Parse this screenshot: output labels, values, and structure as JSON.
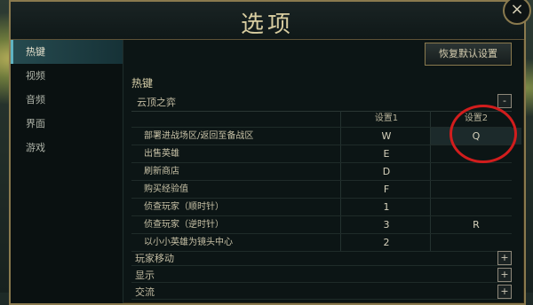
{
  "window": {
    "title": "选项",
    "close_label": "×"
  },
  "sidebar": {
    "items": [
      {
        "label": "热键",
        "active": true
      },
      {
        "label": "视频",
        "active": false
      },
      {
        "label": "音频",
        "active": false
      },
      {
        "label": "界面",
        "active": false
      },
      {
        "label": "游戏",
        "active": false
      }
    ]
  },
  "main": {
    "reset_label": "恢复默认设置",
    "section_title": "热键",
    "group": {
      "label": "云顶之弈",
      "toggle": "-"
    },
    "columns": [
      "设置1",
      "设置2"
    ],
    "rows": [
      {
        "action": "部署进战场区/返回至备战区",
        "key1": "W",
        "key2": "Q"
      },
      {
        "action": "出售英雄",
        "key1": "E",
        "key2": ""
      },
      {
        "action": "刷新商店",
        "key1": "D",
        "key2": ""
      },
      {
        "action": "购买经验值",
        "key1": "F",
        "key2": ""
      },
      {
        "action": "侦查玩家（顺时针）",
        "key1": "1",
        "key2": ""
      },
      {
        "action": "侦查玩家（逆时针）",
        "key1": "3",
        "key2": "R"
      },
      {
        "action": "以小小英雄为镜头中心",
        "key1": "2",
        "key2": ""
      }
    ],
    "collapsed_groups": [
      {
        "label": "玩家移动",
        "toggle": "+"
      },
      {
        "label": "显示",
        "toggle": "+"
      },
      {
        "label": "交流",
        "toggle": "+"
      }
    ]
  },
  "colors": {
    "highlight_circle": "#d21d1d",
    "accent_gold": "#8a7a4e",
    "active_tab": "#264a4f"
  }
}
